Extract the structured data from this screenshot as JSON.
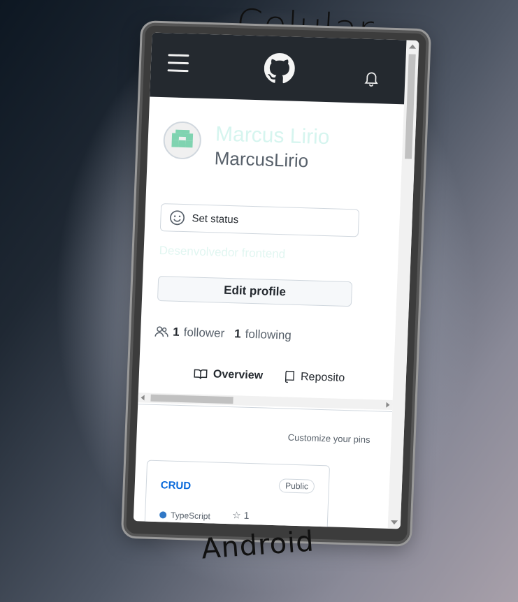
{
  "captions": {
    "top": "Celular",
    "bottom": "Android"
  },
  "profile": {
    "full_name": "Marcus Lirio",
    "username": "MarcusLirio",
    "status_label": "Set status",
    "bio": "Desenvolvedor frontend",
    "edit_label": "Edit profile",
    "followers_count": "1",
    "followers_label": "follower",
    "following_count": "1",
    "following_label": "following"
  },
  "tabs": [
    {
      "label": "Overview",
      "icon": "book-icon",
      "active": true
    },
    {
      "label": "Reposito",
      "icon": "repo-icon",
      "active": false
    }
  ],
  "pins": {
    "customize_label": "Customize your pins",
    "items": [
      {
        "name": "CRUD",
        "visibility": "Public",
        "language": "TypeScript",
        "stars": "1"
      }
    ]
  },
  "colors": {
    "header_bg": "#24292f",
    "link": "#0969da"
  }
}
